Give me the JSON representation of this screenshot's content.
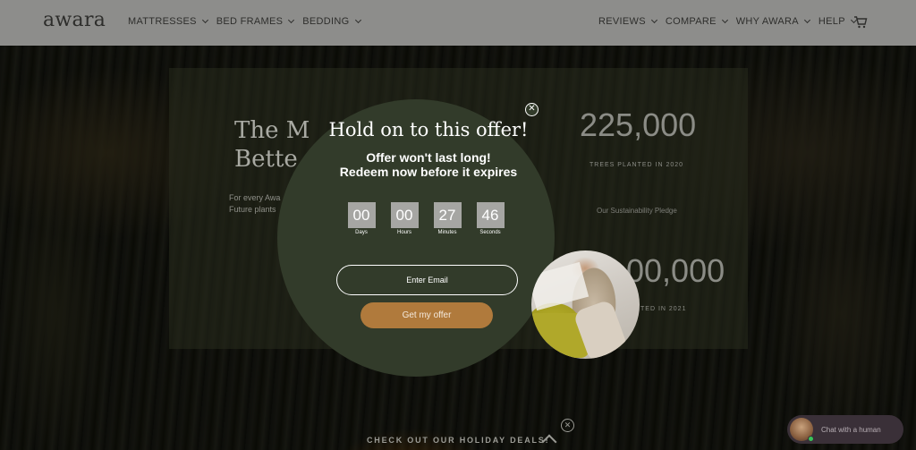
{
  "header": {
    "logo": "awara",
    "nav_left": [
      {
        "label": "MATTRESSES"
      },
      {
        "label": "BED FRAMES"
      },
      {
        "label": "BEDDING"
      }
    ],
    "nav_right": [
      {
        "label": "REVIEWS"
      },
      {
        "label": "COMPARE"
      },
      {
        "label": "WHY AWARA"
      },
      {
        "label": "HELP"
      }
    ],
    "cart_icon": "cart-icon"
  },
  "hero": {
    "title_line1": "The M",
    "title_line2": "Bette",
    "text_line1": "For every Awa",
    "text_line2": "Future plants",
    "stat1_value": "225,000",
    "stat1_label": "TREES PLANTED IN 2020",
    "pledge_link": "Our Sustainability Pledge",
    "stat2_value": "00,000",
    "stat2_label": "TED IN 2021"
  },
  "popup": {
    "title": "Hold on to this offer!",
    "subtitle_line1": "Offer won't last long!",
    "subtitle_line2": "Redeem now before it expires",
    "close_icon": "close-circle-icon",
    "countdown": [
      {
        "value": "00",
        "label": "Days"
      },
      {
        "value": "00",
        "label": "Hours"
      },
      {
        "value": "27",
        "label": "Minutes"
      },
      {
        "value": "46",
        "label": "Seconds"
      }
    ],
    "email_placeholder": "Enter Email",
    "email_value": "",
    "cta_label": "Get my offer"
  },
  "bottom": {
    "deals_label": "CHECK OUT OUR HOLIDAY DEALS!",
    "chevron_icon": "chevron-up-icon",
    "close_icon": "close-circle-icon"
  },
  "chat": {
    "label": "Chat with a human",
    "status": "online"
  }
}
